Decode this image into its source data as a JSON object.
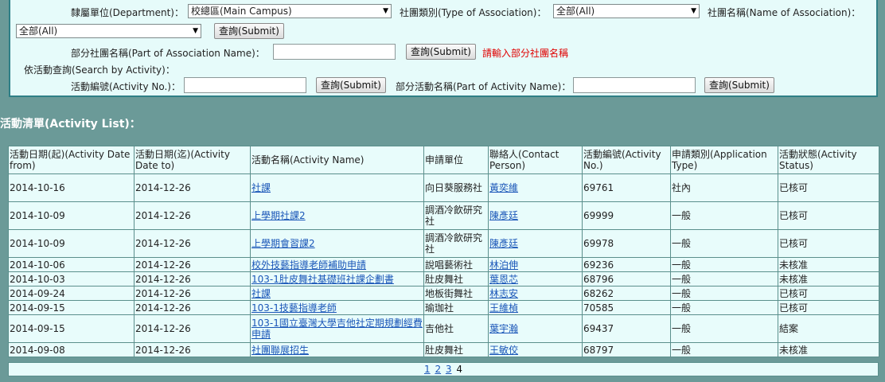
{
  "search": {
    "department_label": "隸屬單位(Department)：",
    "department_value": "校總區(Main Campus)",
    "type_label": "社團類別(Type of Association)：",
    "type_value": "全部(All)",
    "name_label": "社團名稱(Name of Association)：",
    "name_value": "全部(All)",
    "submit1": "查詢(Submit)",
    "part_name_label": "部分社團名稱(Part of Association Name)：",
    "submit2": "查詢(Submit)",
    "part_name_hint": "請輸入部分社團名稱",
    "by_activity_label": "依活動查詢(Search by Activity)：",
    "activity_no_label": "活動編號(Activity No.)：",
    "submit3": "查詢(Submit)",
    "part_activity_label": "部分活動名稱(Part of Activity Name)：",
    "submit4": "查詢(Submit)"
  },
  "list_title": "活動清單(Activity List)：",
  "table": {
    "headers": [
      "活動日期(起)(Activity Date from)",
      "活動日期(迄)(Activity Date to)",
      "活動名稱(Activity Name)",
      "申請單位",
      "聯絡人(Contact Person)",
      "活動編號(Activity No.)",
      "申請類別(Application Type)",
      "活動狀態(Activity Status)"
    ],
    "rows": [
      [
        "2014-10-16",
        "2014-12-26",
        "社課",
        "向日葵服務社",
        "黃奕維",
        "69761",
        "社內",
        "已核可"
      ],
      [
        "2014-10-09",
        "2014-12-26",
        "上學期社課2",
        "調酒冷飲研究社",
        "陳彥廷",
        "69999",
        "一般",
        "已核可"
      ],
      [
        "2014-10-09",
        "2014-12-26",
        "上學期會習課2",
        "調酒冷飲研究社",
        "陳彥廷",
        "69978",
        "一般",
        "已核可"
      ],
      [
        "2014-10-06",
        "2014-12-26",
        "校外技藝指導老師補助申請",
        "說唱藝術社",
        "林泊伸",
        "69236",
        "一般",
        "未核准"
      ],
      [
        "2014-10-03",
        "2014-12-26",
        "103-1肚皮舞社基礎班社課企劃書",
        "肚皮舞社",
        "葉恩芯",
        "68796",
        "一般",
        "未核准"
      ],
      [
        "2014-09-24",
        "2014-12-26",
        "社課",
        "地板街舞社",
        "林志安",
        "68262",
        "一般",
        "已核可"
      ],
      [
        "2014-09-15",
        "2014-12-26",
        "103-1技藝指導老師",
        "瑜珈社",
        "王維楨",
        "70585",
        "一般",
        "已核可"
      ],
      [
        "2014-09-15",
        "2014-12-26",
        "103-1國立臺灣大學吉他社定期規劃經費申請",
        "吉他社",
        "葉宇瀚",
        "69437",
        "一般",
        "結案"
      ],
      [
        "2014-09-08",
        "2014-12-26",
        "社團聯展招生",
        "肚皮舞社",
        "王敏佼",
        "68797",
        "一般",
        "未核准"
      ]
    ]
  },
  "pager": {
    "pages": [
      "1",
      "2",
      "3"
    ],
    "current": "4"
  }
}
